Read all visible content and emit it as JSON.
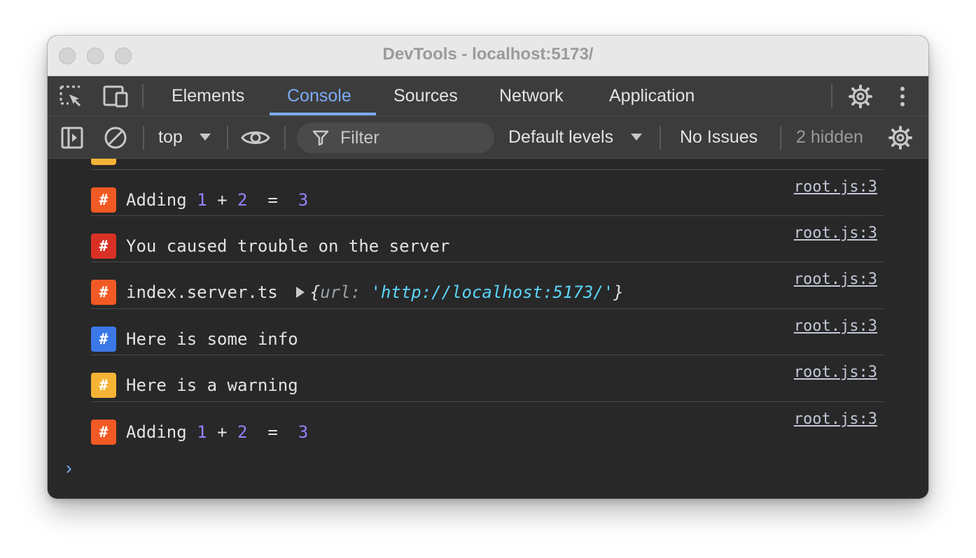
{
  "window": {
    "title": "DevTools - localhost:5173/"
  },
  "tabs": [
    {
      "label": "Elements"
    },
    {
      "label": "Console",
      "active": true
    },
    {
      "label": "Sources"
    },
    {
      "label": "Network"
    },
    {
      "label": "Application"
    }
  ],
  "toolbar": {
    "context": "top",
    "filter_placeholder": "Filter",
    "levels": "Default levels",
    "issues": "No Issues",
    "hidden": "2 hidden"
  },
  "colors": {
    "accent": "#7cacf8",
    "badge_orange": "#f15a24",
    "badge_red": "#d93025",
    "badge_blue": "#3b78e7",
    "badge_yellow": "#f5b335"
  },
  "console_rows": [
    {
      "badge": "#",
      "badge_color": "orange",
      "text": "Adding",
      "num_a": "1",
      "op": "+",
      "num_b": "2",
      "eq": "=",
      "result": "3",
      "source": "root.js:3"
    },
    {
      "badge": "#",
      "badge_color": "red",
      "text": "You caused trouble on the server",
      "source": "root.js:3"
    },
    {
      "badge": "#",
      "badge_color": "orange",
      "text": "index.server.ts",
      "obj_key": "url",
      "obj_value": "'http://localhost:5173/'",
      "source": "root.js:3"
    },
    {
      "badge": "#",
      "badge_color": "blue",
      "text": "Here is some info",
      "source": "root.js:3"
    },
    {
      "badge": "#",
      "badge_color": "yellow",
      "text": "Here is a warning",
      "source": "root.js:3"
    },
    {
      "badge": "#",
      "badge_color": "orange",
      "text": "Adding",
      "num_a": "1",
      "op": "+",
      "num_b": "2",
      "eq": "=",
      "result": "3",
      "source": "root.js:3"
    }
  ],
  "prompt_symbol": "›"
}
